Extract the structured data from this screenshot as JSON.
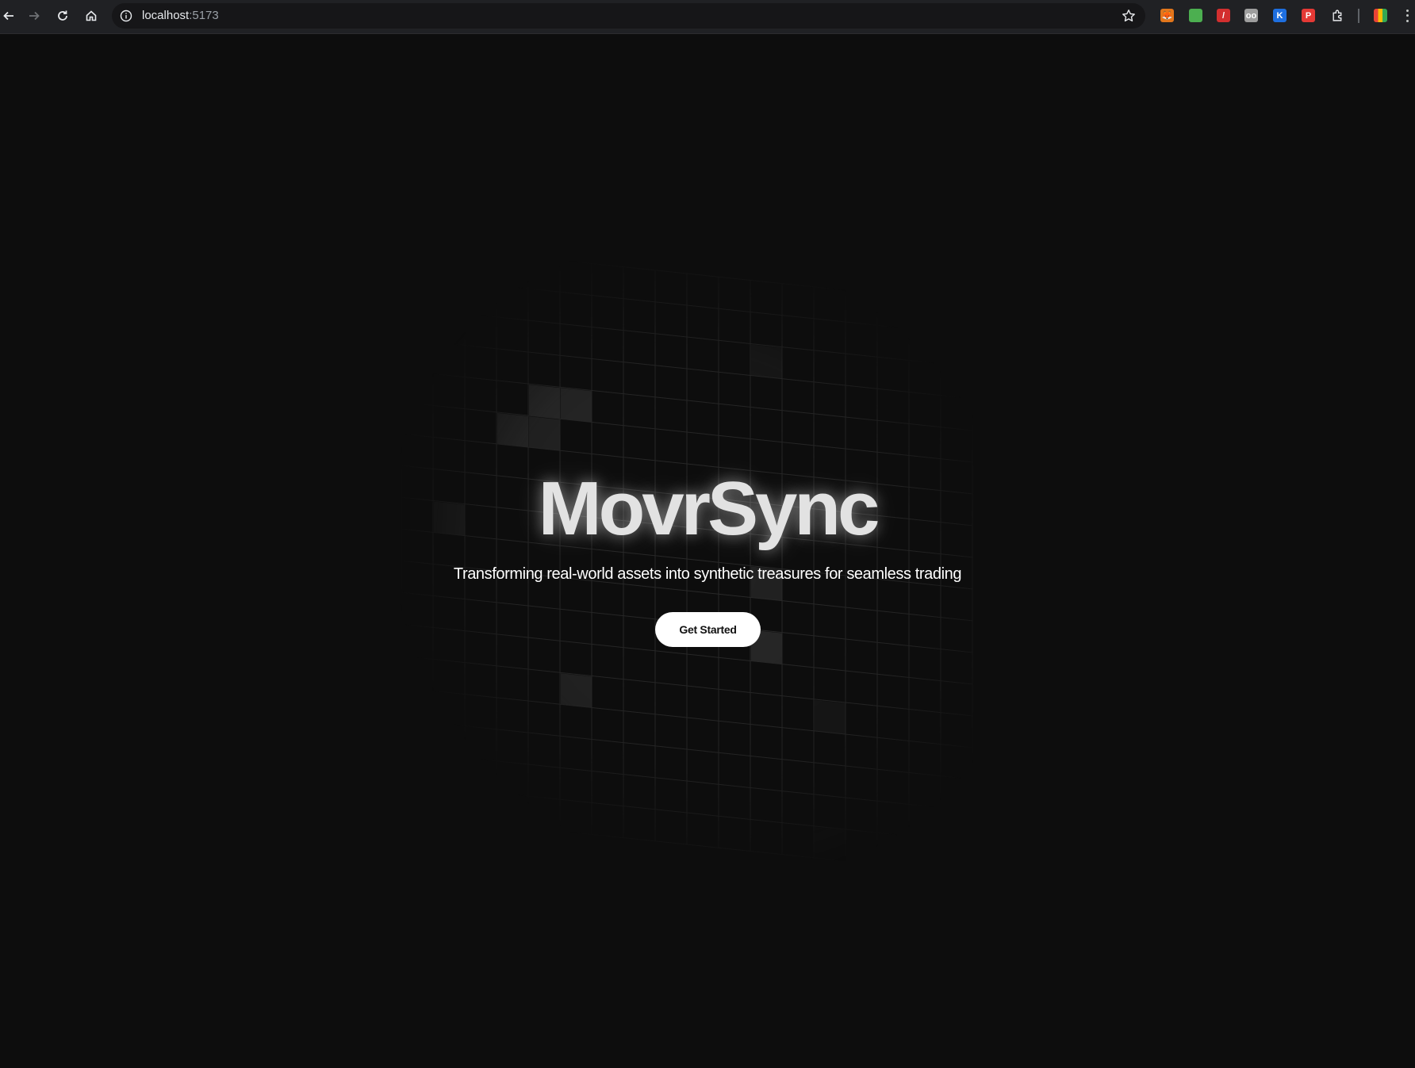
{
  "browser": {
    "url_host": "localhost",
    "url_port": ":5173",
    "extensions": [
      {
        "name": "metamask-extension-icon",
        "color": "#e2761b",
        "glyph": "🦊"
      },
      {
        "name": "green-frog-extension-icon",
        "color": "#4caf50",
        "glyph": ""
      },
      {
        "name": "red-pen-extension-icon",
        "color": "#d32f2f",
        "glyph": "/"
      },
      {
        "name": "owl-extension-icon",
        "color": "#9e9e9e",
        "glyph": "oo"
      },
      {
        "name": "k-extension-icon",
        "color": "#1e6fe0",
        "glyph": "K"
      },
      {
        "name": "red-card-extension-icon",
        "color": "#e53935",
        "glyph": "P"
      },
      {
        "name": "puzzle-extensions-icon",
        "color": "transparent",
        "glyph": ""
      },
      {
        "name": "colorful-extension-icon",
        "color": "#f4b400",
        "glyph": ""
      }
    ]
  },
  "hero": {
    "title": "MovrSync",
    "subtitle": "Transforming real-world assets into synthetic treasures for seamless trading",
    "cta_label": "Get Started"
  },
  "colors": {
    "background": "#0d0d0d",
    "grid_line": "#2a2a2a",
    "highlight_cell": "#2c2c2c",
    "button_bg": "#ffffff",
    "title": "#e2e2e2"
  }
}
